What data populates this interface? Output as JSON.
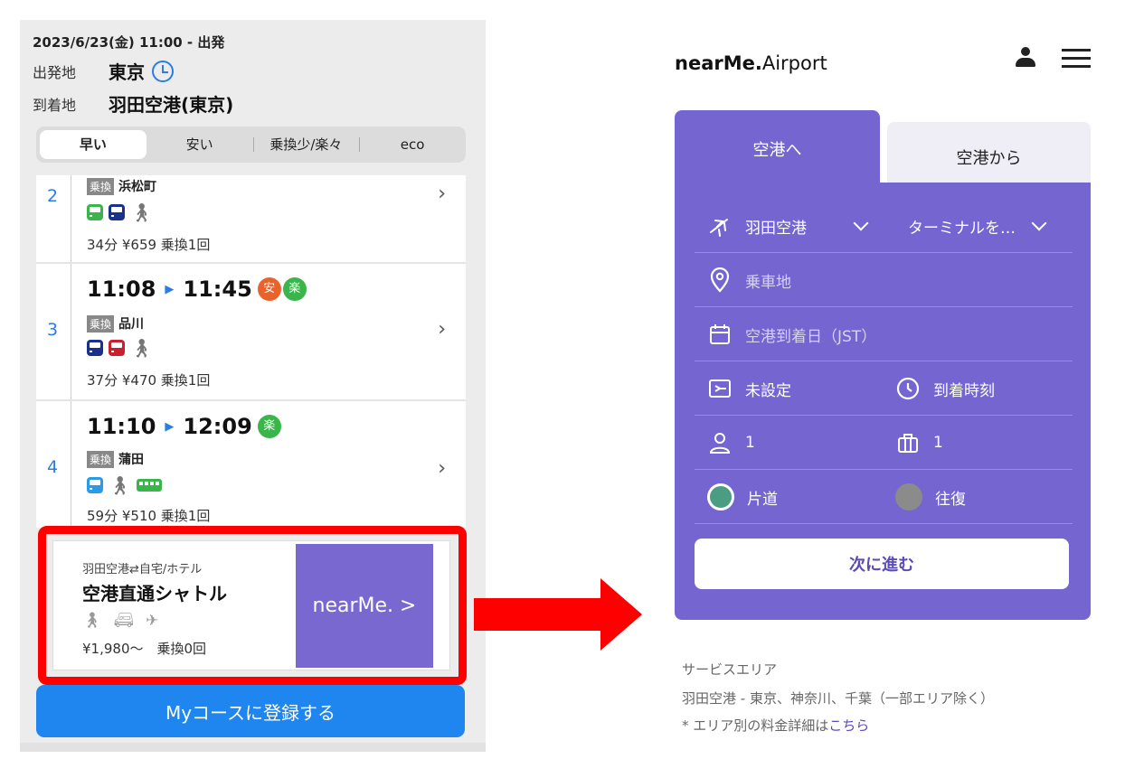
{
  "left": {
    "date_line": "2023/6/23(金) 11:00 - 出発",
    "origin_label": "出発地",
    "origin_value": "東京",
    "dest_label": "到着地",
    "dest_value": "羽田空港(東京)",
    "tabs": [
      "早い",
      "安い",
      "乗換少/楽々",
      "eco"
    ],
    "routes": [
      {
        "num": "2",
        "transfer_tag": "乗換",
        "transfer_station": "浜松町",
        "meta": "34分 ¥659 乗換1回"
      },
      {
        "num": "3",
        "dep": "11:08",
        "arr": "11:45",
        "badges": [
          "安",
          "楽"
        ],
        "transfer_tag": "乗換",
        "transfer_station": "品川",
        "meta": "37分 ¥470 乗換1回"
      },
      {
        "num": "4",
        "dep": "11:10",
        "arr": "12:09",
        "badges": [
          "楽"
        ],
        "transfer_tag": "乗換",
        "transfer_station": "蒲田",
        "meta": "59分 ¥510 乗換1回"
      }
    ],
    "shuttle": {
      "subtitle": "羽田空港⇄自宅/ホテル",
      "title": "空港直通シャトル",
      "price": "¥1,980〜　乗換0回",
      "brand": "nearMe. >"
    },
    "register_button": "Myコースに登録する"
  },
  "right": {
    "logo_main": "nearMe.",
    "logo_sub": "Airport",
    "tab_active": "空港へ",
    "tab_inactive": "空港から",
    "airport": "羽田空港",
    "terminal": "ターミナルを…",
    "pickup_placeholder": "乗車地",
    "date_placeholder": "空港到着日（JST）",
    "flight": "未設定",
    "arrival_time": "到着時刻",
    "passengers": "1",
    "luggage": "1",
    "one_way": "片道",
    "round_trip": "往復",
    "next_button": "次に進む",
    "service_title": "サービスエリア",
    "service_area": "羽田空港 - 東京、神奈川、千葉（一部エリア除く）",
    "fee_note_prefix": "* エリア別の料金詳細は",
    "fee_note_link": "こちら"
  },
  "colors": {
    "accent_blue": "#1f86f0",
    "nearme_purple": "#7565d1",
    "highlight_red": "#ff0000",
    "radio_selected": "#4a9d83"
  }
}
